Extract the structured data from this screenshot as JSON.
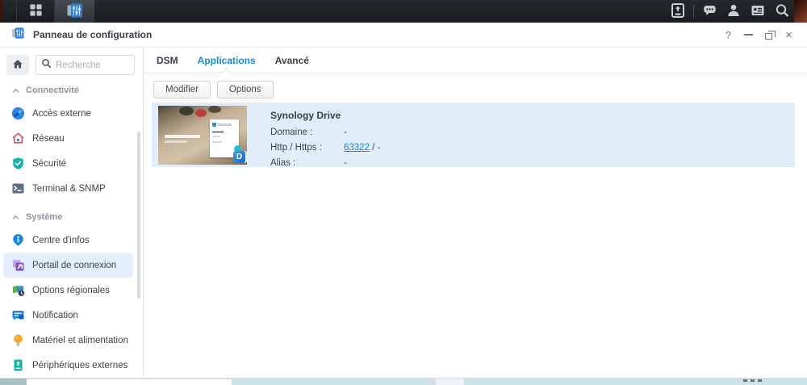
{
  "colors": {
    "accent_blue": "#0f8ce9",
    "selection_bg": "#e1eefa",
    "sidebar_selected": "#e3effc",
    "taskbar_bg": "#1d2023",
    "link": "#0f8ce9"
  },
  "taskbar": {
    "left_icons": [
      "show-desktop",
      "main-menu-grid",
      "control-panel-app"
    ],
    "right_icons": [
      "backup",
      "chat",
      "user",
      "widgets",
      "search"
    ]
  },
  "window": {
    "title": "Panneau de configuration",
    "controls": {
      "help": "?",
      "close": "×"
    }
  },
  "sidebar": {
    "search": {
      "placeholder": "Recherche",
      "value": ""
    },
    "sections": [
      {
        "label": "Connectivité",
        "items": [
          {
            "label": "Accès externe",
            "icon": "external-access"
          },
          {
            "label": "Réseau",
            "icon": "network"
          },
          {
            "label": "Sécurité",
            "icon": "security"
          },
          {
            "label": "Terminal & SNMP",
            "icon": "terminal"
          }
        ]
      },
      {
        "label": "Système",
        "items": [
          {
            "label": "Centre d'infos",
            "icon": "info-center"
          },
          {
            "label": "Portail de connexion",
            "icon": "login-portal",
            "selected": true
          },
          {
            "label": "Options régionales",
            "icon": "regional-options"
          },
          {
            "label": "Notification",
            "icon": "notification"
          },
          {
            "label": "Matériel et alimentation",
            "icon": "hardware-power"
          },
          {
            "label": "Périphériques externes",
            "icon": "external-devices"
          }
        ]
      }
    ]
  },
  "main": {
    "tabs": [
      {
        "label": "DSM",
        "active": false
      },
      {
        "label": "Applications",
        "active": true
      },
      {
        "label": "Avancé",
        "active": false
      }
    ],
    "toolbar": {
      "modify": "Modifier",
      "options": "Options"
    },
    "application": {
      "name": "Synology Drive",
      "badge_letter": "D",
      "fields": {
        "domain_label": "Domaine :",
        "domain_value": "-",
        "http_label": "Http / Https :",
        "http_link": "63322",
        "http_suffix": " / -",
        "alias_label": "Alias :",
        "alias_value": "-"
      }
    }
  }
}
